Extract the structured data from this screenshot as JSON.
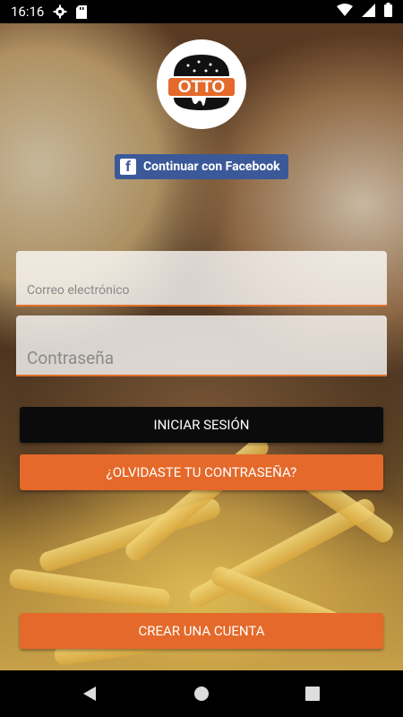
{
  "status_bar": {
    "time": "16:16",
    "icons": [
      "gear-icon",
      "sd-card-icon",
      "wifi-icon",
      "signal-icon",
      "battery-icon"
    ]
  },
  "brand": {
    "logo_text": "OTTO",
    "accent_color": "#e4692a"
  },
  "facebook": {
    "label": "Continuar con Facebook",
    "color": "#3b5998"
  },
  "form": {
    "email_placeholder": "Correo electrónico",
    "password_placeholder": "Contraseña"
  },
  "buttons": {
    "login": "INICIAR SESIÓN",
    "forgot": "¿OLVIDASTE TU CONTRASEÑA?",
    "create": "CREAR UNA CUENTA"
  },
  "nav_bar": {
    "icons": [
      "back-icon",
      "home-icon",
      "recents-icon"
    ]
  }
}
